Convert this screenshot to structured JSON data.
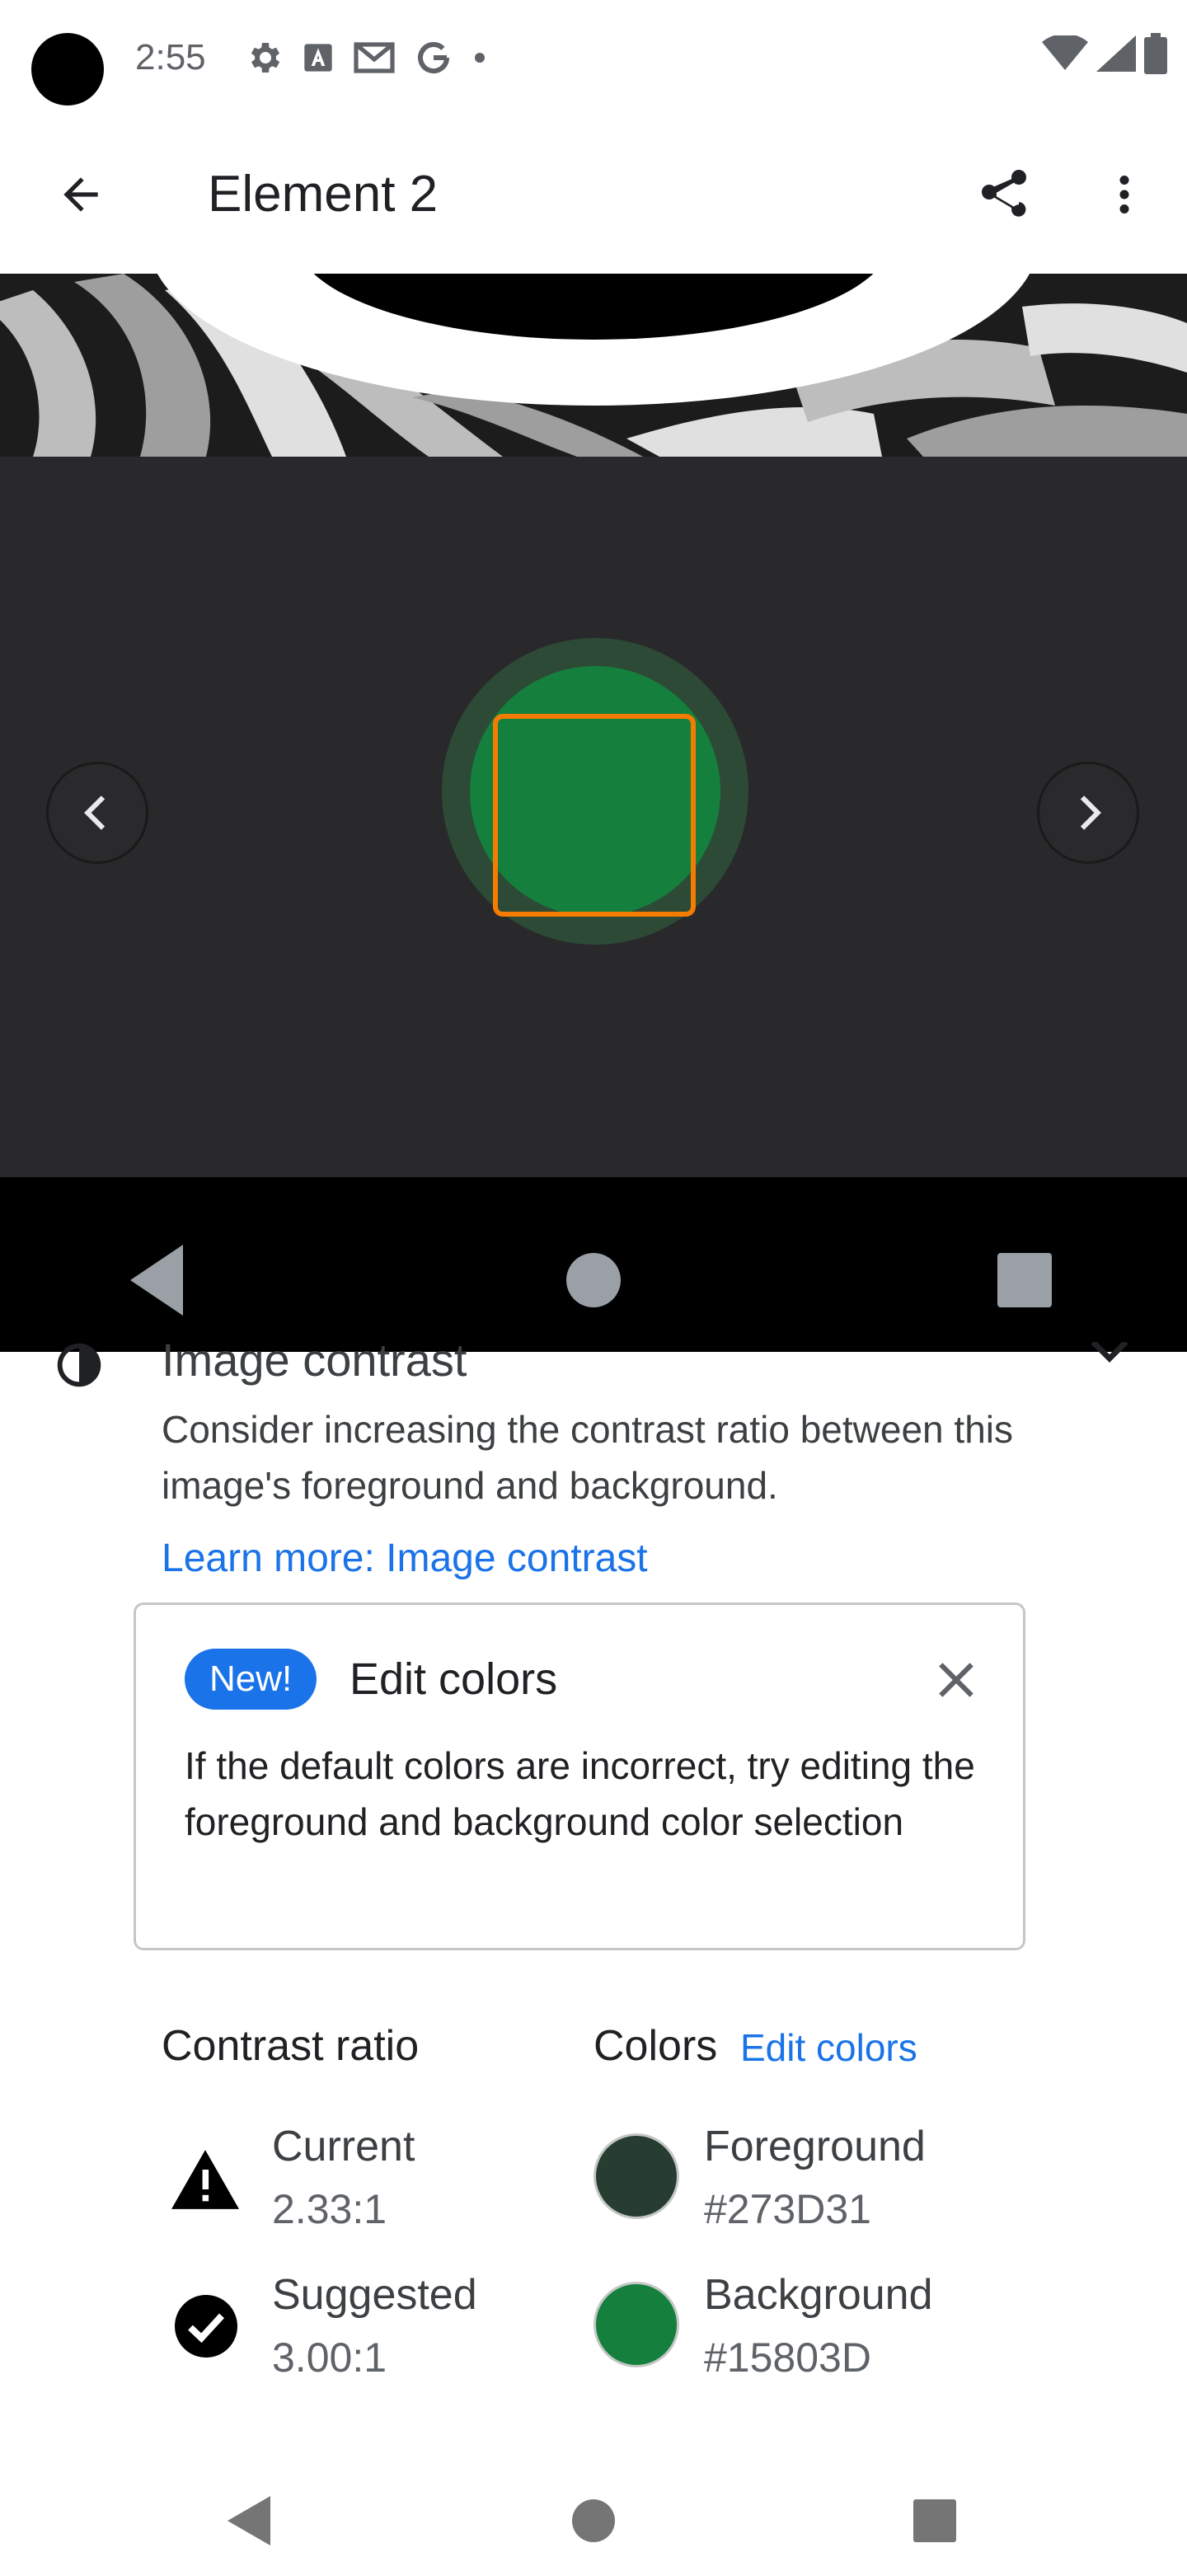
{
  "status_bar": {
    "time": "2:55",
    "icons": [
      "settings-icon",
      "a-icon",
      "gmail-icon",
      "google-icon",
      "dot-icon",
      "wifi-icon",
      "signal-icon",
      "battery-icon"
    ]
  },
  "app_bar": {
    "title": "Element 2"
  },
  "result": {
    "title": "Image contrast",
    "description": "Consider increasing the contrast ratio between this image's foreground and background.",
    "learn_more": "Learn more: Image contrast"
  },
  "edit_card": {
    "badge": "New!",
    "title": "Edit colors",
    "body": "If the default colors are incorrect, try editing the foreground and background color selection"
  },
  "contrast": {
    "title": "Contrast ratio",
    "current_label": "Current",
    "current_value": "2.33:1",
    "suggested_label": "Suggested",
    "suggested_value": "3.00:1"
  },
  "colors": {
    "title": "Colors",
    "edit_link": "Edit colors",
    "foreground_label": "Foreground",
    "foreground_value": "#273D31",
    "background_label": "Background",
    "background_value": "#15803D"
  },
  "palette": {
    "accent": "#1a73e8",
    "highlight": "#f57c00",
    "foreground": "#273d31",
    "background": "#15803d"
  }
}
